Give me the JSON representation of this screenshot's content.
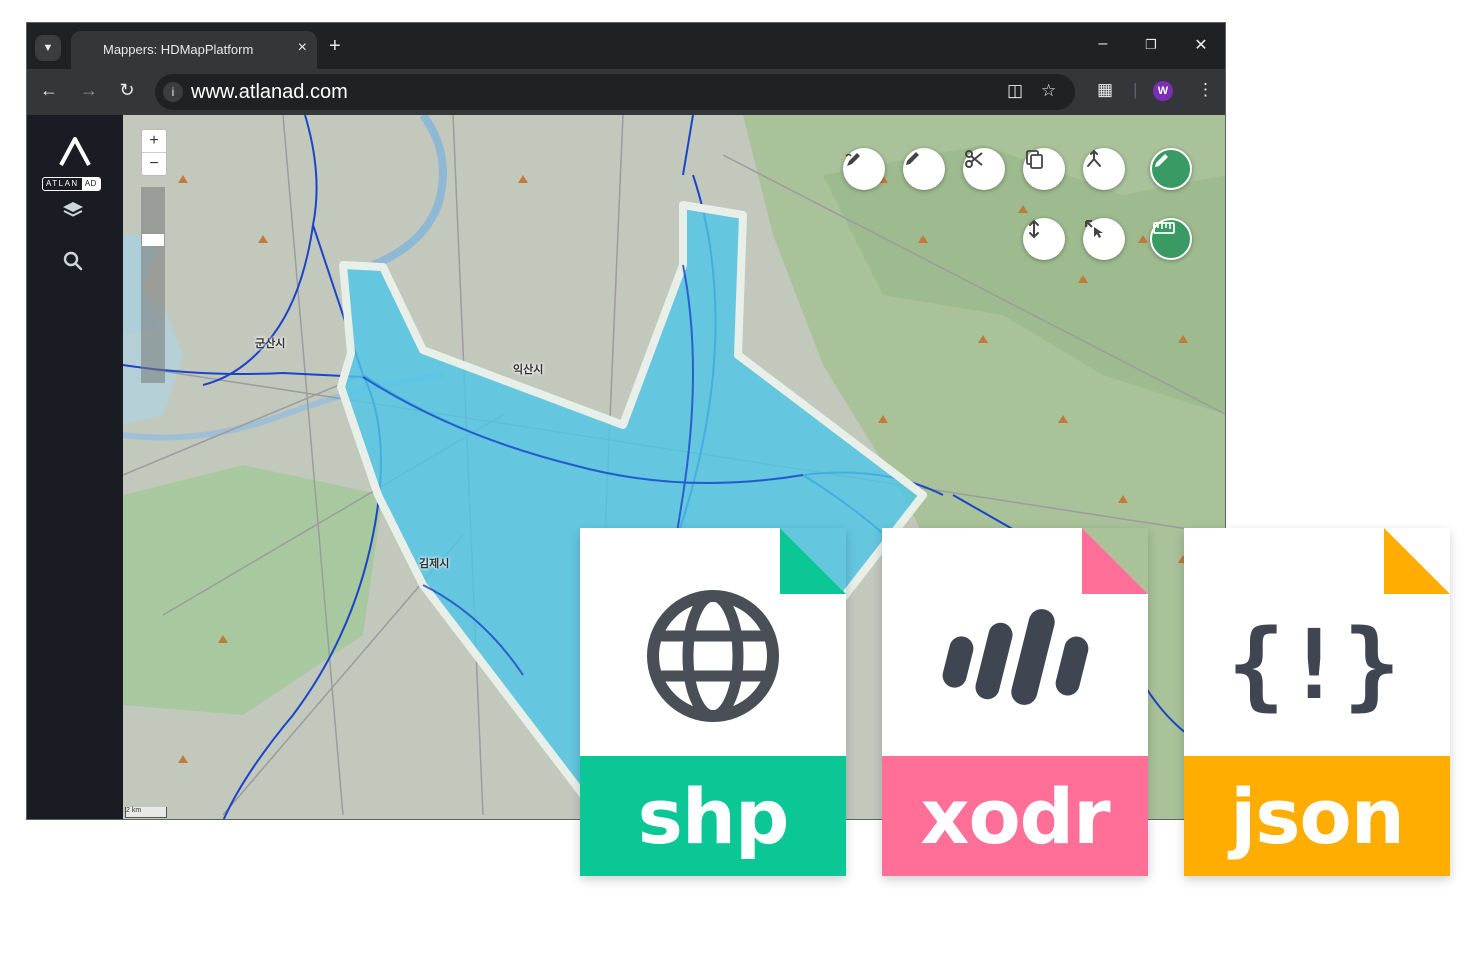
{
  "browser": {
    "tab_title": "Mappers: HDMapPlatform",
    "tab_close_icon": "×",
    "new_tab_icon": "+",
    "url": "www.atlanad.com",
    "avatar_initial": "W"
  },
  "app": {
    "logo_text": "ATLAN",
    "logo_badge": "AD"
  },
  "map": {
    "zoom_in": "+",
    "zoom_out": "−",
    "scale_label": "2 km",
    "highlight_color": "#4fc6e6",
    "labels": {
      "gunsan": "군산시",
      "iksan": "익산시",
      "gimje": "김제시"
    }
  },
  "tools": {
    "draw_tool_icon": "pen-scribble-icon",
    "edit_icon": "pencil-icon",
    "cut_icon": "scissors-icon",
    "copy_icon": "copy-icon",
    "merge_icon": "merge-icon",
    "active_edit_icon": "pencil-icon",
    "vertical_move_icon": "vertical-arrows-icon",
    "resize_icon": "resize-pointer-icon",
    "measure_icon": "ruler-icon",
    "accent_color": "#3a9a64"
  },
  "exports": [
    {
      "label": "shp",
      "color": "#0bc796",
      "icon": "globe-icon"
    },
    {
      "label": "xodr",
      "color": "#ff6f98",
      "icon": "road-bars-icon"
    },
    {
      "label": "json",
      "color": "#ffad00",
      "icon": "json-braces-icon",
      "glyph": "{!}"
    }
  ]
}
